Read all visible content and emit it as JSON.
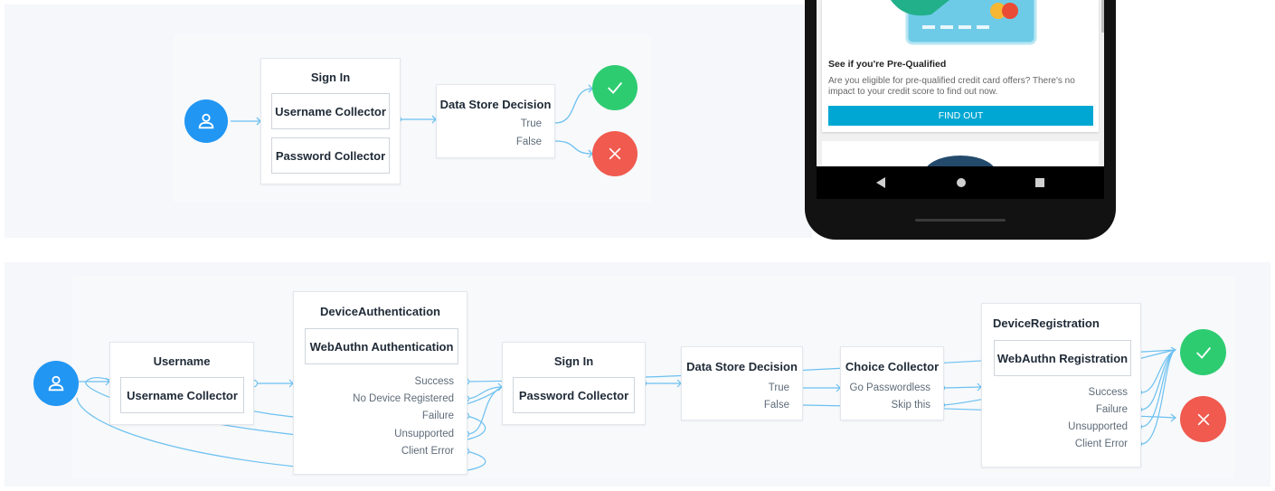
{
  "top_flow": {
    "sign_in": {
      "title": "Sign In",
      "items": [
        "Username Collector",
        "Password Collector"
      ]
    },
    "decision": {
      "title": "Data Store Decision",
      "outcomes": [
        "True",
        "False"
      ]
    }
  },
  "bottom_flow": {
    "username": {
      "title": "Username",
      "items": [
        "Username Collector"
      ]
    },
    "device_auth": {
      "title": "DeviceAuthentication",
      "items": [
        "WebAuthn Authentication"
      ],
      "outcomes": [
        "Success",
        "No Device Registered",
        "Failure",
        "Unsupported",
        "Client Error"
      ]
    },
    "sign_in": {
      "title": "Sign In",
      "items": [
        "Password Collector"
      ]
    },
    "decision": {
      "title": "Data Store Decision",
      "outcomes": [
        "True",
        "False"
      ]
    },
    "choice": {
      "title": "Choice Collector",
      "outcomes": [
        "Go Passwordless",
        "Skip this"
      ]
    },
    "device_reg": {
      "title": "DeviceRegistration",
      "items": [
        "WebAuthn Registration"
      ],
      "outcomes": [
        "Success",
        "Failure",
        "Unsupported",
        "Client Error"
      ]
    }
  },
  "phone": {
    "card_heading": "See if you're Pre-Qualified",
    "card_body": "Are you eligible for pre-qualified credit card offers? There's no impact to your credit score to find out now.",
    "cta_label": "FIND OUT"
  },
  "colors": {
    "start": "#2196f3",
    "success": "#2ecc71",
    "fail": "#f05a4f",
    "wire": "#6cc0f0",
    "cta": "#00a7d3"
  },
  "icons": [
    "user-icon",
    "checkmark-icon",
    "close-icon",
    "back-icon",
    "home-icon",
    "recents-icon"
  ]
}
